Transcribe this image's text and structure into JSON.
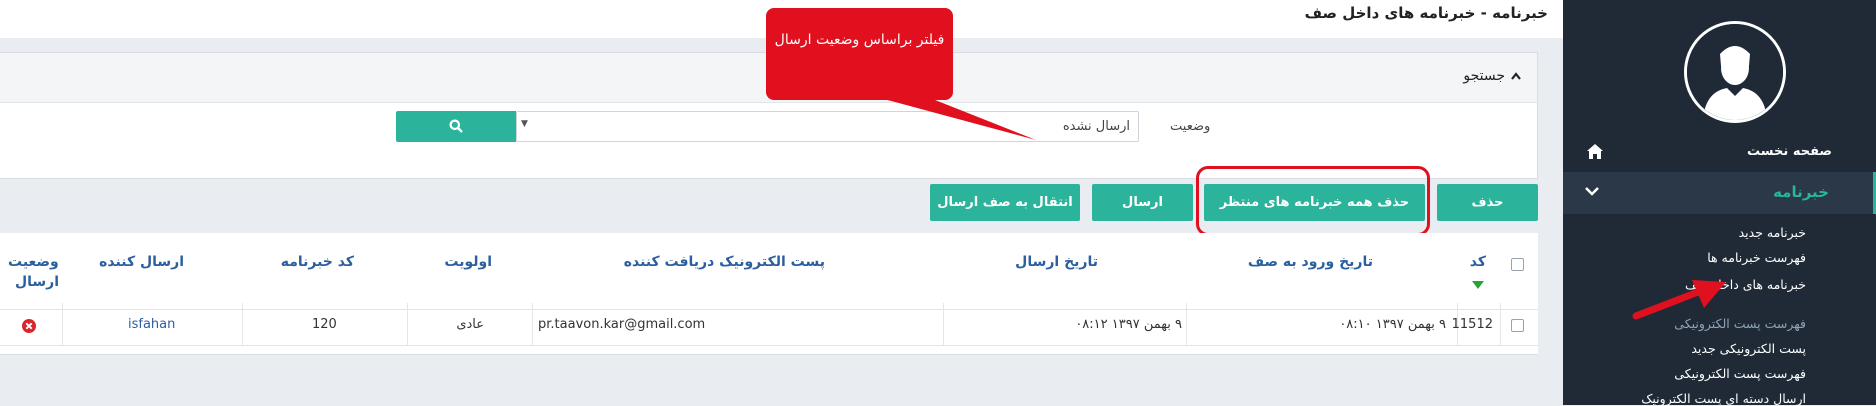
{
  "page": {
    "title": "خبرنامه - خبرنامه های داخل صف"
  },
  "sidebar": {
    "home_label": "صفحه نخست",
    "newsletter_label": "خبرنامه",
    "items": [
      {
        "label": "خبرنامه جدید"
      },
      {
        "label": "فهرست خبرنامه ها"
      },
      {
        "label": "خبرنامه های داخل صف"
      },
      {
        "label": "فهرست پست الکترونیکی"
      },
      {
        "label": "پست الکترونیکی جدید"
      },
      {
        "label": "فهرست پست الکترونیکی"
      },
      {
        "label": "ارسال دسته ای پست الکترونیک"
      }
    ]
  },
  "search": {
    "header_label": "جستجو",
    "status_label": "وضعیت",
    "status_value": "ارسال نشده"
  },
  "annotation": {
    "tooltip_text": "فیلتر براساس وضعیت ارسال"
  },
  "toolbar": {
    "delete_label": "حذف",
    "delete_all_label": "حذف همه خبرنامه های منتظر ارسال",
    "send_label": "ارسال",
    "move_label": "انتقال به صف ارسال"
  },
  "table": {
    "headers": {
      "code": "کد",
      "queue_date": "تاریخ ورود به صف",
      "send_date": "تاریخ ارسال",
      "recipient": "پست الکترونیک دریافت کننده",
      "priority": "اولویت",
      "newsletter_code": "کد خبرنامه",
      "sender": "ارسال کننده",
      "status_line1": "وضعیت",
      "status_line2": "ارسال"
    },
    "rows": [
      {
        "code": "11512",
        "queue_date": "۹ بهمن ۱۳۹۷ ۰۸:۱۰",
        "send_date": "۹ بهمن ۱۳۹۷ ۰۸:۱۲",
        "recipient": "pr.taavon.kar@gmail.com",
        "priority": "عادی",
        "newsletter_code": "120",
        "sender": "isfahan",
        "status_icon": "error-circle-icon"
      }
    ]
  },
  "colors": {
    "accent": "#2bb39b",
    "sidebar_bg": "#1f2a36",
    "annotation_red": "#e0101e",
    "link_blue": "#2b5fa0"
  }
}
